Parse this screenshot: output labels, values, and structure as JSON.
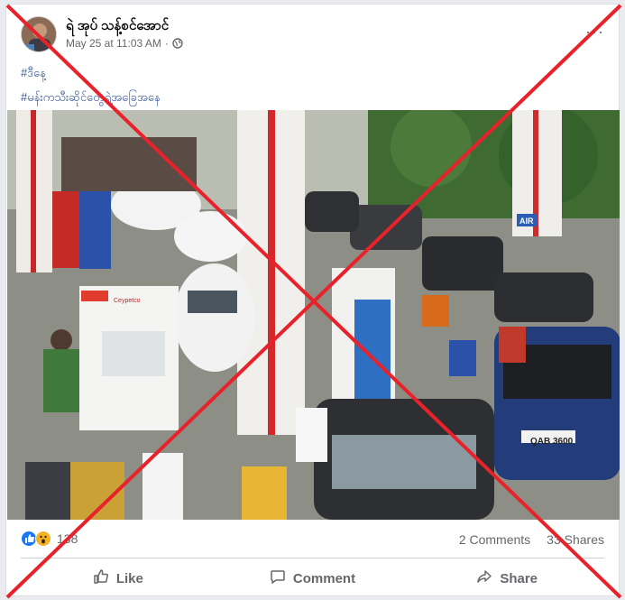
{
  "post": {
    "author": "ရဲ အုပ် သန့်စင်အောင်",
    "timestamp": "May 25 at 11:03 AM",
    "separator": "·",
    "more_label": "···",
    "hashtags": [
      "#ဒီနေ့",
      "#မန်းကသီးဆိုင်တွေရဲ့အခြေအနေ"
    ]
  },
  "photo": {
    "pump_brand": "Ceypetco",
    "air_sign": "AIR",
    "plate": "QAB 3600"
  },
  "stats": {
    "reaction_count": "138",
    "comments": "2 Comments",
    "shares": "33 Shares"
  },
  "actions": {
    "like": "Like",
    "comment": "Comment",
    "share": "Share"
  },
  "colors": {
    "link": "#385898",
    "overlay_cross": "#e8222b",
    "like_blue": "#1877f2"
  }
}
